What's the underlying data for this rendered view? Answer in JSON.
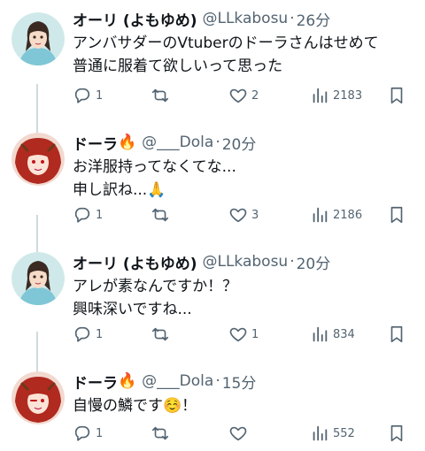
{
  "colors": {
    "text": "#0f1419",
    "muted": "#536471",
    "thread_line": "#cfd9de"
  },
  "tweets": [
    {
      "name": "オーリ (よもゆめ)",
      "handle": "@LLkabosu",
      "dot": "·",
      "time": "26分",
      "lines": [
        "アンバサダーのVtuberのドーラさんはせめて",
        "普通に服着て欲しいって思った"
      ],
      "emoji": "",
      "replies": "1",
      "retweets": "",
      "likes": "2",
      "views": "2183"
    },
    {
      "name": "ドーラ",
      "name_emoji": "🔥",
      "handle": "@___Dola",
      "dot": "·",
      "time": "20分",
      "lines": [
        "お洋服持ってなくてな...",
        "申し訳ね..."
      ],
      "emoji": "🙏",
      "replies": "1",
      "retweets": "",
      "likes": "3",
      "views": "2186"
    },
    {
      "name": "オーリ (よもゆめ)",
      "handle": "@LLkabosu",
      "dot": "·",
      "time": "20分",
      "lines": [
        "アレが素なんですか！？",
        "興味深いですね..."
      ],
      "emoji": "",
      "replies": "1",
      "retweets": "",
      "likes": "1",
      "views": "834"
    },
    {
      "name": "ドーラ",
      "name_emoji": "🔥",
      "handle": "@___Dola",
      "dot": "·",
      "time": "15分",
      "lines": [
        "自慢の鱗です"
      ],
      "emoji": "☺️",
      "line_suffix": "！",
      "replies": "1",
      "retweets": "",
      "likes": "",
      "views": "552"
    }
  ],
  "icons": {
    "reply": "reply-icon",
    "retweet": "retweet-icon",
    "like": "heart-icon",
    "views": "views-icon",
    "bookmark": "bookmark-icon"
  }
}
